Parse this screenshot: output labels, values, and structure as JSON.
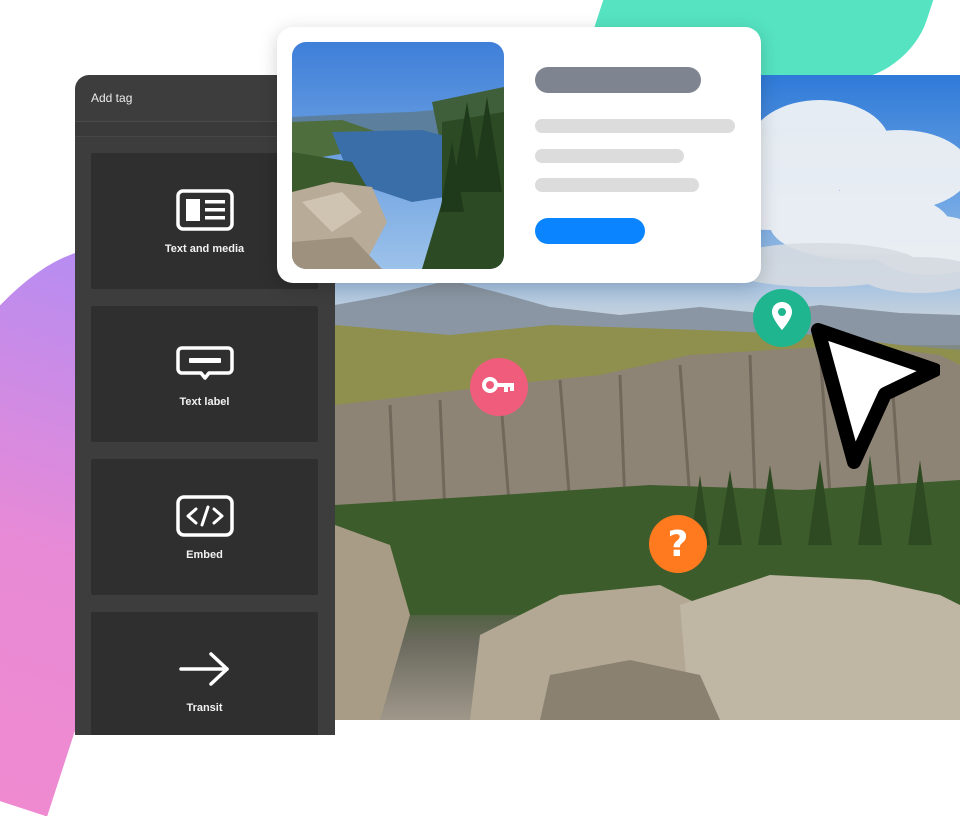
{
  "sidebar": {
    "title": "Add tag",
    "items": [
      {
        "label": "Text and media",
        "icon": "text-and-media-icon"
      },
      {
        "label": "Text label",
        "icon": "text-label-icon"
      },
      {
        "label": "Embed",
        "icon": "code-embed-icon"
      },
      {
        "label": "Transit",
        "icon": "arrow-right-icon"
      }
    ]
  },
  "card": {
    "photo": "lake-photo",
    "button_color": "#0a84ff"
  },
  "markers": [
    {
      "icon": "key-icon",
      "color": "#f05d7c"
    },
    {
      "icon": "location-pin-icon",
      "color": "#1fb58e"
    },
    {
      "icon": "question-icon",
      "color": "#ff7a1f",
      "text": "?"
    }
  ],
  "cursor": {
    "icon": "arrow-cursor-icon"
  }
}
